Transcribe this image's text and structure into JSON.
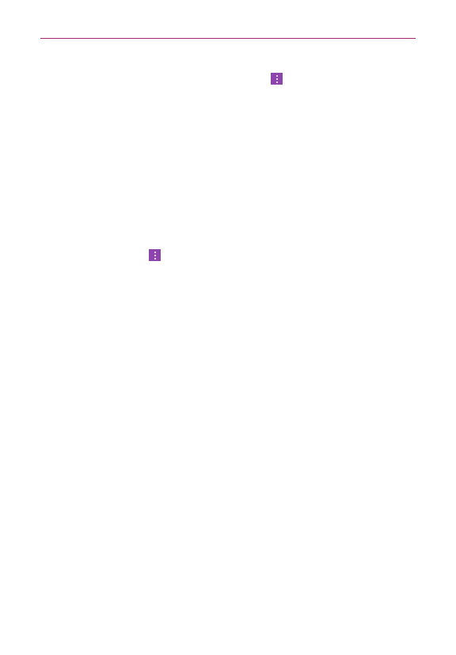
{
  "header": {
    "rule_color": "#a3246f"
  },
  "icons": [
    {
      "name": "more-options-icon",
      "color": "#8e44ad"
    },
    {
      "name": "more-options-icon",
      "color": "#8e44ad"
    }
  ]
}
